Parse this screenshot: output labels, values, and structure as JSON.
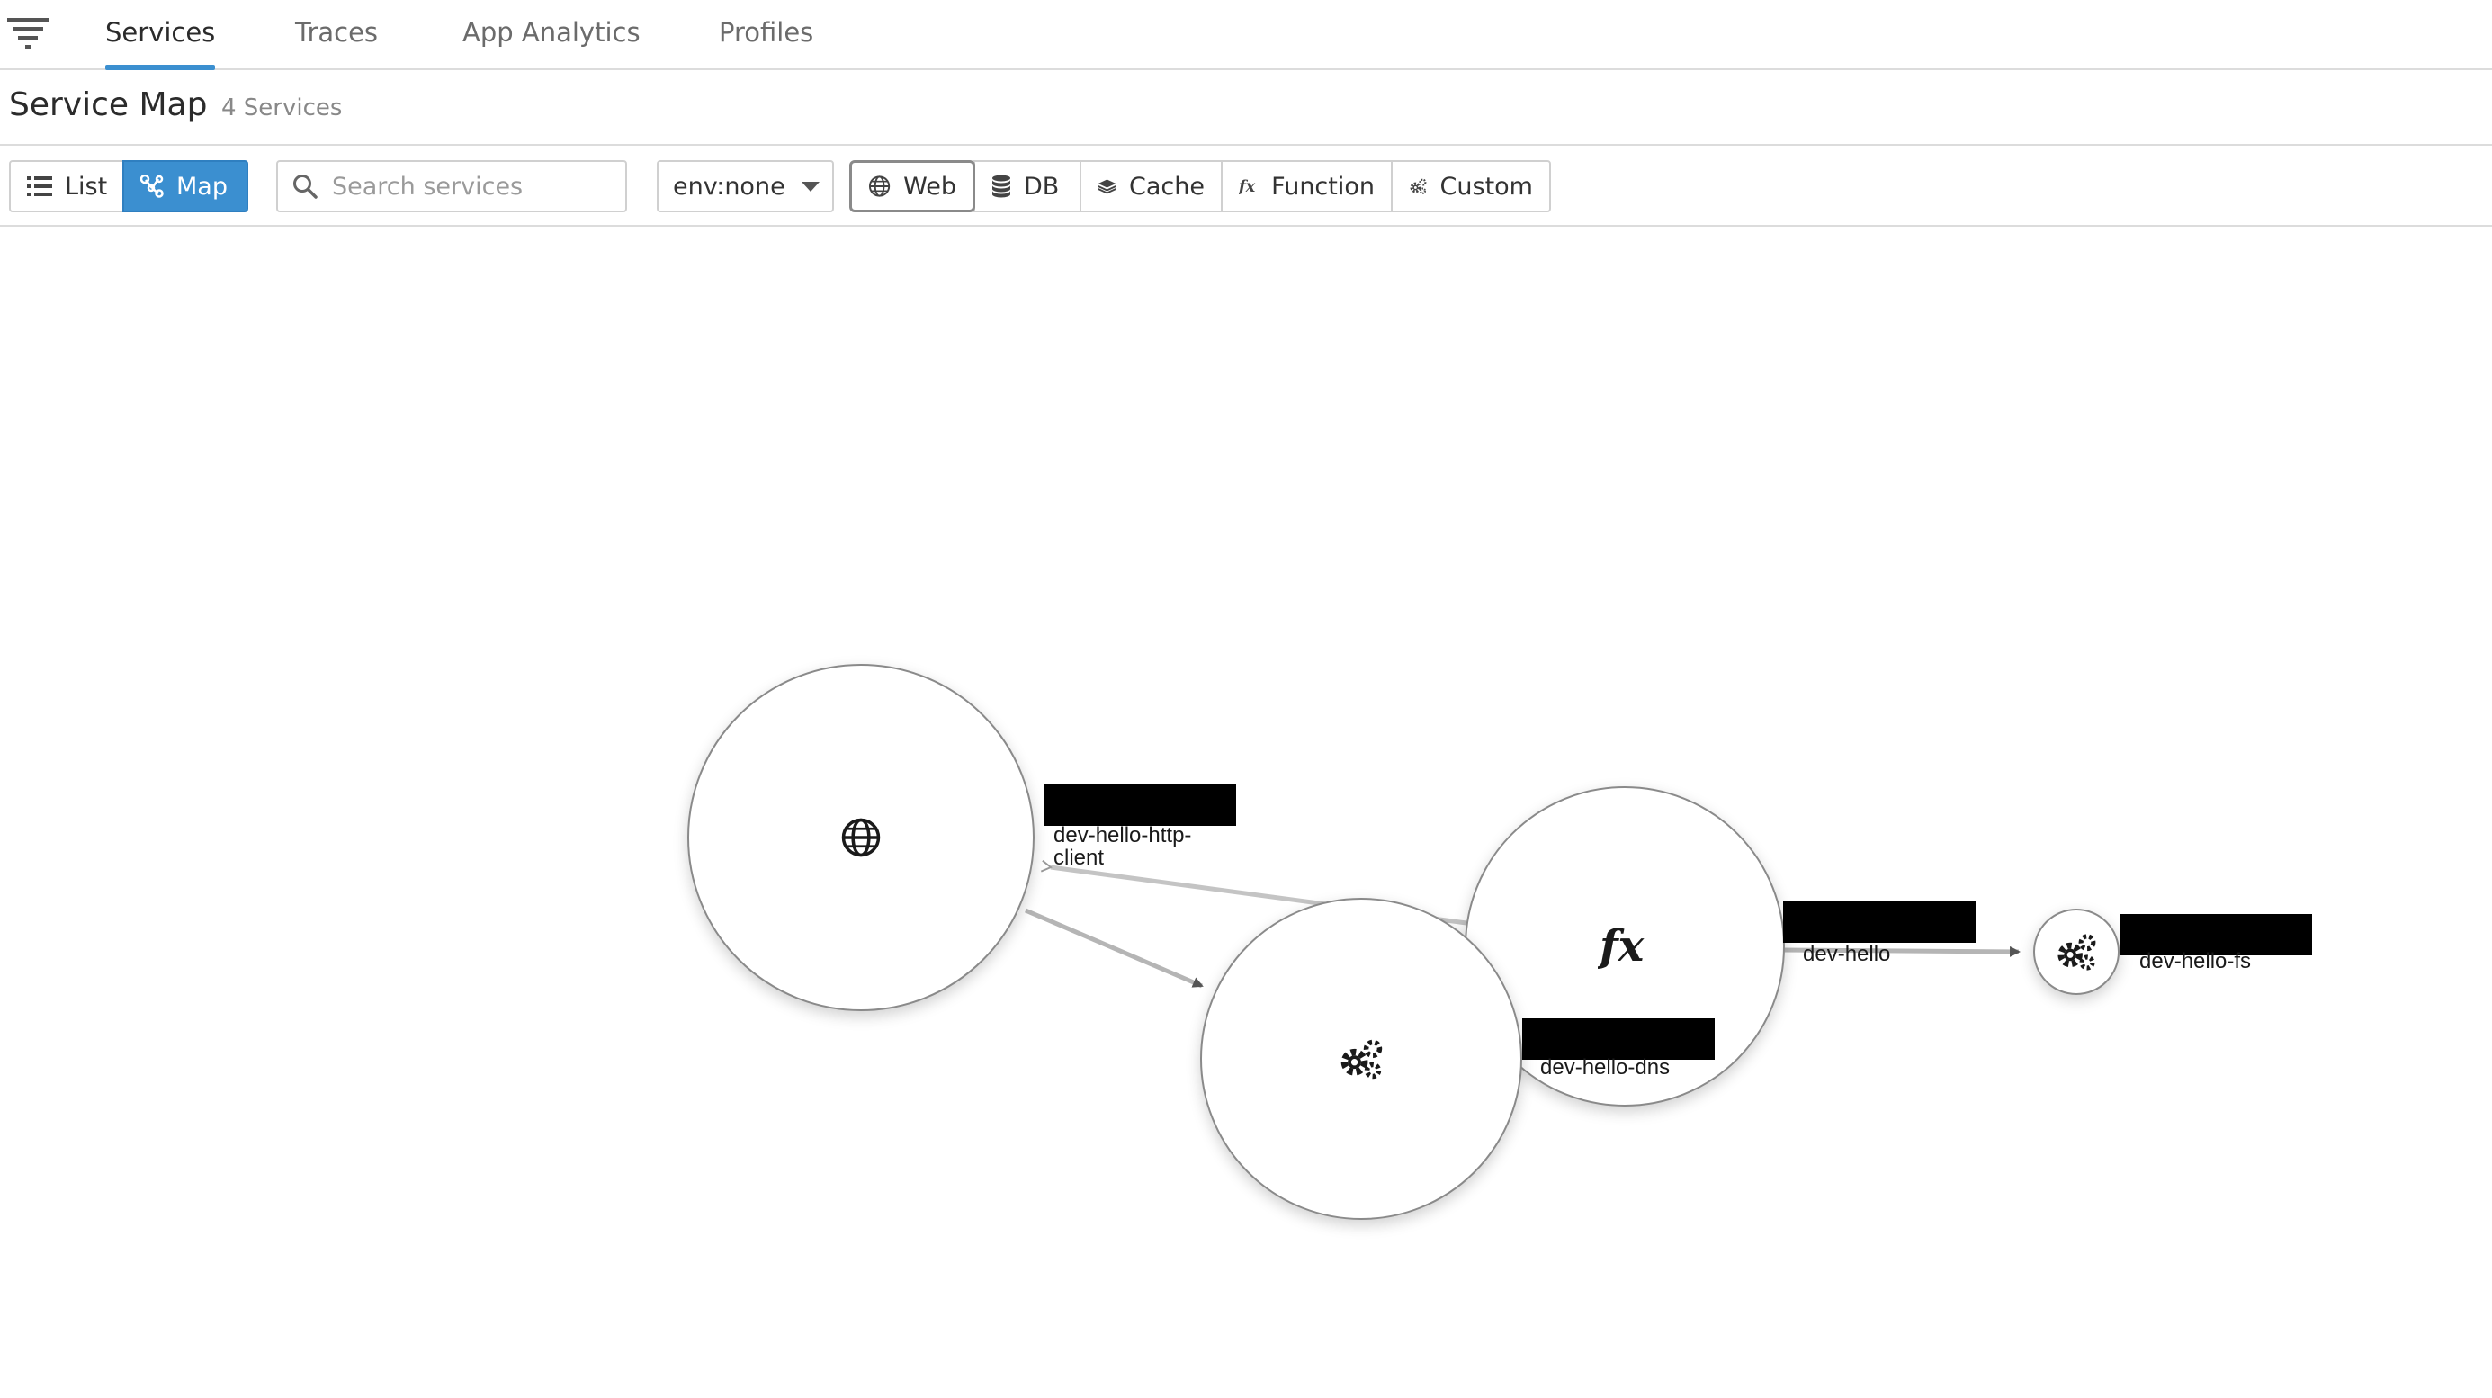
{
  "nav": {
    "tabs": [
      {
        "label": "Services",
        "active": true
      },
      {
        "label": "Traces",
        "active": false
      },
      {
        "label": "App Analytics",
        "active": false
      },
      {
        "label": "Profiles",
        "active": false
      }
    ]
  },
  "header": {
    "title": "Service Map",
    "service_count": "4 Services"
  },
  "toolbar": {
    "view_toggle": {
      "list_label": "List",
      "map_label": "Map",
      "selected": "Map"
    },
    "search": {
      "placeholder": "Search services",
      "value": ""
    },
    "env_filter": {
      "value": "env:none"
    },
    "type_filters": [
      {
        "label": "Web",
        "icon": "globe-icon",
        "selected": true
      },
      {
        "label": "DB",
        "icon": "database-icon",
        "selected": false
      },
      {
        "label": "Cache",
        "icon": "layers-icon",
        "selected": false
      },
      {
        "label": "Function",
        "icon": "function-icon",
        "selected": false
      },
      {
        "label": "Custom",
        "icon": "gears-icon",
        "selected": false
      }
    ]
  },
  "map": {
    "nodes": [
      {
        "label": "dev-hello-http-\nclient",
        "type": "web",
        "icon": "globe-icon"
      },
      {
        "label": "dev-hello-dns",
        "type": "custom",
        "icon": "gears-icon"
      },
      {
        "label": "dev-hello",
        "type": "function",
        "icon": "function-icon"
      },
      {
        "label": "dev-hello-fs",
        "type": "custom",
        "icon": "gears-icon"
      }
    ],
    "edges": [
      {
        "from": "dev-hello-http-\nclient",
        "to": "dev-hello-dns"
      },
      {
        "from": "dev-hello",
        "to": "dev-hello-http-\nclient"
      },
      {
        "from": "dev-hello",
        "to": "dev-hello-fs"
      }
    ]
  },
  "colors": {
    "accent": "#3b8fd0",
    "node_border": "#8a8a8a",
    "edge": "#b5b5b5",
    "redaction": "#000000"
  }
}
